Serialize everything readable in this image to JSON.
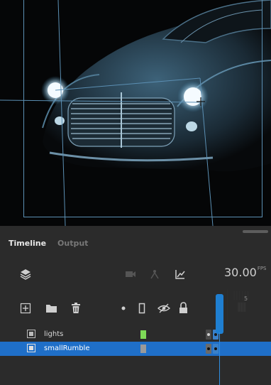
{
  "timeline": {
    "tabs": [
      {
        "label": "Timeline",
        "active": true
      },
      {
        "label": "Output",
        "active": false
      }
    ],
    "fps_value": "30.00",
    "fps_unit": "FPS",
    "frame_label": "5",
    "layers": [
      {
        "name": "lights",
        "color": "#7ed957",
        "selected": false
      },
      {
        "name": "smallRumble",
        "color": "#9a9a9a",
        "selected": true
      }
    ]
  },
  "colors": {
    "panel_bg": "#2b2b2b",
    "selection": "#1f6fc8",
    "playhead": "#1f7fd1",
    "guide": "#5b8fb3"
  },
  "icons": {
    "layers": "layers-icon",
    "camera": "camera-icon",
    "puppet": "puppet-icon",
    "graph": "graph-icon",
    "new_layer": "new-layer-icon",
    "folder": "new-folder-icon",
    "trash": "delete-icon",
    "dot": "show-dot-icon",
    "outline": "outline-icon",
    "hide": "hide-icon",
    "lock": "lock-icon"
  }
}
